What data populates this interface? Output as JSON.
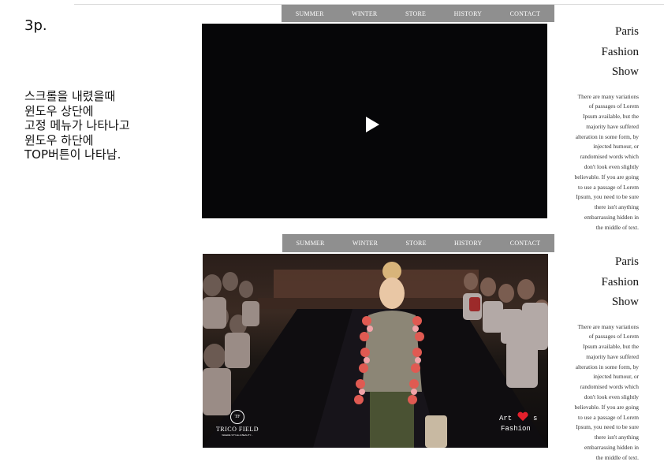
{
  "page_label": "3p.",
  "description_lines": [
    "스크롤을 내렸을때",
    "윈도우 상단에",
    "고정 메뉴가 나타나고",
    "윈도우 하단에",
    "TOP버튼이 나타남."
  ],
  "nav": {
    "items": [
      "SUMMER",
      "WINTER",
      "STORE",
      "HISTORY",
      "CONTACT"
    ]
  },
  "side": {
    "title_lines": [
      "Paris",
      "Fashion",
      "Show"
    ],
    "body_lines": [
      "There are many variations",
      "of passages of Lorem",
      "Ipsum available, but the",
      "majority have suffered",
      "alteration in some form, by",
      "injected humour, or",
      "randomised words which",
      "don't look even slightly",
      "believable. If you are going",
      "to use a passage of Lorem",
      "Ipsum, you need to be sure",
      "there isn't anything",
      "embarrassing hidden in",
      "the middle of text."
    ]
  },
  "video_overlay": {
    "brand_name": "TRICO FIELD",
    "brand_tagline": "WHERE STYLE & BEAUTY...",
    "badge_line1": "Art",
    "badge_suffix": "s",
    "badge_line2": "Fashion"
  },
  "colors": {
    "nav_bg": "#8f8f8f",
    "video_bg": "#060608",
    "heart": "#e3202c"
  },
  "icons": [
    "play-icon",
    "heart-icon",
    "trico-field-logo"
  ]
}
